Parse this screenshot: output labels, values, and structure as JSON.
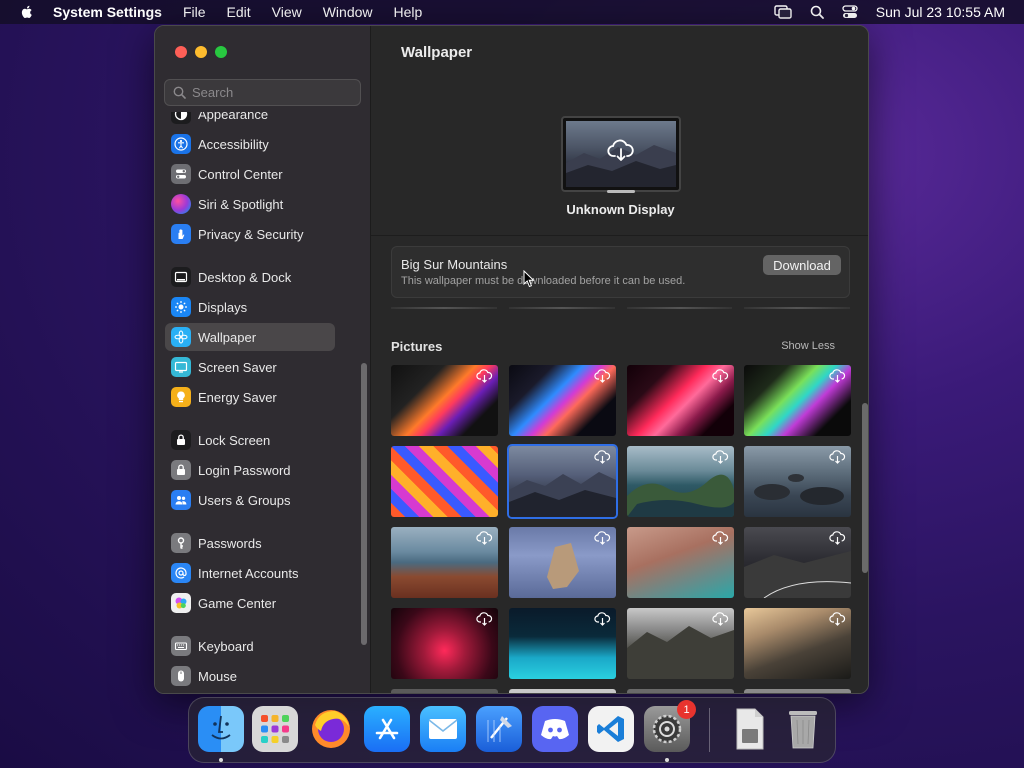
{
  "menubar": {
    "app_name": "System Settings",
    "menus": [
      "File",
      "Edit",
      "View",
      "Window",
      "Help"
    ],
    "datetime": "Sun Jul 23  10:55 AM"
  },
  "sidebar": {
    "search_placeholder": "Search",
    "items": [
      {
        "label": "Appearance",
        "icon": "appearance-icon",
        "color": "#1c1c1e"
      },
      {
        "label": "Accessibility",
        "icon": "accessibility-icon",
        "color": "#1a73e8"
      },
      {
        "label": "Control Center",
        "icon": "control-center-icon",
        "color": "#6e6e73"
      },
      {
        "label": "Siri & Spotlight",
        "icon": "siri-icon",
        "color": "#9b3ad8"
      },
      {
        "label": "Privacy & Security",
        "icon": "hand-icon",
        "color": "#2a7ef2"
      },
      {
        "label": "Desktop & Dock",
        "icon": "dock-icon",
        "color": "#1c1c1e"
      },
      {
        "label": "Displays",
        "icon": "displays-icon",
        "color": "#1a86f5"
      },
      {
        "label": "Wallpaper",
        "icon": "wallpaper-icon",
        "color": "#2ab0f5"
      },
      {
        "label": "Screen Saver",
        "icon": "screen-saver-icon",
        "color": "#35b8d6"
      },
      {
        "label": "Energy Saver",
        "icon": "energy-saver-icon",
        "color": "#f5b01a"
      },
      {
        "label": "Lock Screen",
        "icon": "lock-icon",
        "color": "#1c1c1e"
      },
      {
        "label": "Login Password",
        "icon": "login-password-icon",
        "color": "#7a7a7e"
      },
      {
        "label": "Users & Groups",
        "icon": "users-icon",
        "color": "#2a7ef2"
      },
      {
        "label": "Passwords",
        "icon": "key-icon",
        "color": "#7a7a7e"
      },
      {
        "label": "Internet Accounts",
        "icon": "at-icon",
        "color": "#2a86f5"
      },
      {
        "label": "Game Center",
        "icon": "game-center-icon",
        "color": "#f0f0f0"
      },
      {
        "label": "Keyboard",
        "icon": "keyboard-icon",
        "color": "#7a7a7e"
      },
      {
        "label": "Mouse",
        "icon": "mouse-icon",
        "color": "#7a7a7e"
      }
    ],
    "active_item": "Wallpaper"
  },
  "content": {
    "title": "Wallpaper",
    "display_name": "Unknown Display",
    "notice": {
      "title": "Big Sur Mountains",
      "description": "This wallpaper must be downloaded before it can be used.",
      "button": "Download"
    },
    "section_label": "Pictures",
    "section_toggle": "Show Less"
  },
  "dock": {
    "apps": [
      "Finder",
      "Launchpad",
      "Firefox",
      "App Store",
      "Mail",
      "Xcode",
      "Discord",
      "Visual Studio Code",
      "System Settings",
      "Downloads",
      "Trash"
    ],
    "system_settings_badge": "1"
  },
  "colors": {
    "accent": "#2f6ee6",
    "close": "#fe5f57",
    "minimize": "#febc2e",
    "maximize": "#28c840"
  }
}
